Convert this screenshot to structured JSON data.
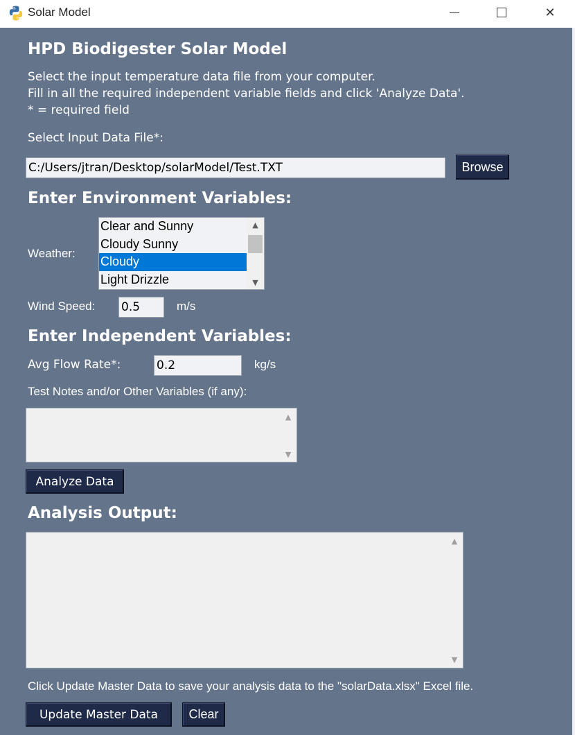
{
  "window": {
    "title": "Solar Model",
    "minimize_glyph": "",
    "maximize_glyph": "",
    "close_glyph": "✕"
  },
  "header": {
    "title": "HPD Biodigester Solar Model",
    "instructions": [
      "Select the input temperature data file from your computer.",
      "Fill in all the required independent variable fields and click 'Analyze Data'.",
      "* = required field"
    ]
  },
  "file": {
    "label": "Select Input Data File*:",
    "path": "C:/Users/jtran/Desktop/solarModel/Test.TXT",
    "browse_label": "Browse"
  },
  "environment": {
    "heading": "Enter Environment Variables:",
    "weather_label": "Weather:",
    "weather_options": [
      "Clear and Sunny",
      "Cloudy Sunny",
      "Cloudy",
      "Light Drizzle"
    ],
    "weather_selected": "Cloudy",
    "wind_label": "Wind Speed:",
    "wind_value": "0.5",
    "wind_unit": "m/s"
  },
  "independent": {
    "heading": "Enter Independent Variables:",
    "flow_label": "Avg Flow Rate*:",
    "flow_value": "0.2",
    "flow_unit": "kg/s",
    "notes_label": "Test Notes and/or Other Variables (if any):",
    "notes_value": ""
  },
  "actions": {
    "analyze_label": "Analyze Data"
  },
  "output": {
    "heading": "Analysis Output:",
    "text": "",
    "save_hint": "Click Update Master Data to save your analysis data to the \"solarData.xlsx\" Excel file.",
    "update_label": "Update Master Data",
    "clear_label": "Clear"
  },
  "icons": {
    "app": "python-icon",
    "scroll_up": "▲",
    "scroll_down": "▼"
  },
  "colors": {
    "background": "#64748b",
    "button": "#1e2a48",
    "selection": "#0078d7",
    "field": "#f0f2f5"
  }
}
